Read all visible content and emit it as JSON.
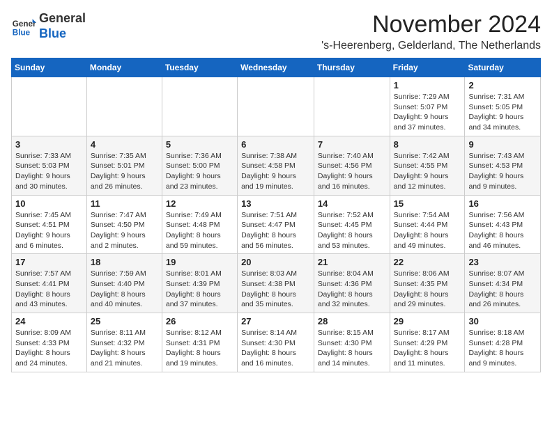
{
  "logo": {
    "general": "General",
    "blue": "Blue"
  },
  "title": "November 2024",
  "subtitle": "'s-Heerenberg, Gelderland, The Netherlands",
  "days_header": [
    "Sunday",
    "Monday",
    "Tuesday",
    "Wednesday",
    "Thursday",
    "Friday",
    "Saturday"
  ],
  "weeks": [
    [
      {
        "day": "",
        "info": ""
      },
      {
        "day": "",
        "info": ""
      },
      {
        "day": "",
        "info": ""
      },
      {
        "day": "",
        "info": ""
      },
      {
        "day": "",
        "info": ""
      },
      {
        "day": "1",
        "info": "Sunrise: 7:29 AM\nSunset: 5:07 PM\nDaylight: 9 hours and 37 minutes."
      },
      {
        "day": "2",
        "info": "Sunrise: 7:31 AM\nSunset: 5:05 PM\nDaylight: 9 hours and 34 minutes."
      }
    ],
    [
      {
        "day": "3",
        "info": "Sunrise: 7:33 AM\nSunset: 5:03 PM\nDaylight: 9 hours and 30 minutes."
      },
      {
        "day": "4",
        "info": "Sunrise: 7:35 AM\nSunset: 5:01 PM\nDaylight: 9 hours and 26 minutes."
      },
      {
        "day": "5",
        "info": "Sunrise: 7:36 AM\nSunset: 5:00 PM\nDaylight: 9 hours and 23 minutes."
      },
      {
        "day": "6",
        "info": "Sunrise: 7:38 AM\nSunset: 4:58 PM\nDaylight: 9 hours and 19 minutes."
      },
      {
        "day": "7",
        "info": "Sunrise: 7:40 AM\nSunset: 4:56 PM\nDaylight: 9 hours and 16 minutes."
      },
      {
        "day": "8",
        "info": "Sunrise: 7:42 AM\nSunset: 4:55 PM\nDaylight: 9 hours and 12 minutes."
      },
      {
        "day": "9",
        "info": "Sunrise: 7:43 AM\nSunset: 4:53 PM\nDaylight: 9 hours and 9 minutes."
      }
    ],
    [
      {
        "day": "10",
        "info": "Sunrise: 7:45 AM\nSunset: 4:51 PM\nDaylight: 9 hours and 6 minutes."
      },
      {
        "day": "11",
        "info": "Sunrise: 7:47 AM\nSunset: 4:50 PM\nDaylight: 9 hours and 2 minutes."
      },
      {
        "day": "12",
        "info": "Sunrise: 7:49 AM\nSunset: 4:48 PM\nDaylight: 8 hours and 59 minutes."
      },
      {
        "day": "13",
        "info": "Sunrise: 7:51 AM\nSunset: 4:47 PM\nDaylight: 8 hours and 56 minutes."
      },
      {
        "day": "14",
        "info": "Sunrise: 7:52 AM\nSunset: 4:45 PM\nDaylight: 8 hours and 53 minutes."
      },
      {
        "day": "15",
        "info": "Sunrise: 7:54 AM\nSunset: 4:44 PM\nDaylight: 8 hours and 49 minutes."
      },
      {
        "day": "16",
        "info": "Sunrise: 7:56 AM\nSunset: 4:43 PM\nDaylight: 8 hours and 46 minutes."
      }
    ],
    [
      {
        "day": "17",
        "info": "Sunrise: 7:57 AM\nSunset: 4:41 PM\nDaylight: 8 hours and 43 minutes."
      },
      {
        "day": "18",
        "info": "Sunrise: 7:59 AM\nSunset: 4:40 PM\nDaylight: 8 hours and 40 minutes."
      },
      {
        "day": "19",
        "info": "Sunrise: 8:01 AM\nSunset: 4:39 PM\nDaylight: 8 hours and 37 minutes."
      },
      {
        "day": "20",
        "info": "Sunrise: 8:03 AM\nSunset: 4:38 PM\nDaylight: 8 hours and 35 minutes."
      },
      {
        "day": "21",
        "info": "Sunrise: 8:04 AM\nSunset: 4:36 PM\nDaylight: 8 hours and 32 minutes."
      },
      {
        "day": "22",
        "info": "Sunrise: 8:06 AM\nSunset: 4:35 PM\nDaylight: 8 hours and 29 minutes."
      },
      {
        "day": "23",
        "info": "Sunrise: 8:07 AM\nSunset: 4:34 PM\nDaylight: 8 hours and 26 minutes."
      }
    ],
    [
      {
        "day": "24",
        "info": "Sunrise: 8:09 AM\nSunset: 4:33 PM\nDaylight: 8 hours and 24 minutes."
      },
      {
        "day": "25",
        "info": "Sunrise: 8:11 AM\nSunset: 4:32 PM\nDaylight: 8 hours and 21 minutes."
      },
      {
        "day": "26",
        "info": "Sunrise: 8:12 AM\nSunset: 4:31 PM\nDaylight: 8 hours and 19 minutes."
      },
      {
        "day": "27",
        "info": "Sunrise: 8:14 AM\nSunset: 4:30 PM\nDaylight: 8 hours and 16 minutes."
      },
      {
        "day": "28",
        "info": "Sunrise: 8:15 AM\nSunset: 4:30 PM\nDaylight: 8 hours and 14 minutes."
      },
      {
        "day": "29",
        "info": "Sunrise: 8:17 AM\nSunset: 4:29 PM\nDaylight: 8 hours and 11 minutes."
      },
      {
        "day": "30",
        "info": "Sunrise: 8:18 AM\nSunset: 4:28 PM\nDaylight: 8 hours and 9 minutes."
      }
    ]
  ]
}
